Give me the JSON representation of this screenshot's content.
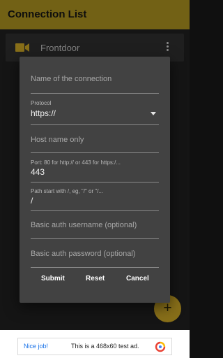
{
  "app": {
    "title": "Connection List"
  },
  "list": {
    "items": [
      {
        "label": "Frontdoor",
        "icon": "videocam-icon"
      }
    ]
  },
  "dialog": {
    "fields": {
      "name": {
        "placeholder": "Name of the connection",
        "value": ""
      },
      "protocol": {
        "label": "Protocol",
        "value": "https://"
      },
      "host": {
        "placeholder": "Host name only",
        "value": ""
      },
      "port": {
        "label": "Port: 80 for http:// or 443 for https:/...",
        "value": "443"
      },
      "path": {
        "label": "Path start with /, eg, \"/\" or \"/...",
        "value": "/"
      },
      "username": {
        "placeholder": "Basic auth username (optional)",
        "value": ""
      },
      "password": {
        "placeholder": "Basic auth password (optional)",
        "value": ""
      }
    },
    "buttons": {
      "submit": "Submit",
      "reset": "Reset",
      "cancel": "Cancel"
    }
  },
  "fab": {
    "label": "+"
  },
  "ad": {
    "badge": "Nice job!",
    "message": "This is a 468x60 test ad."
  },
  "colors": {
    "appbar": "#a8901f",
    "accent": "#c9a426",
    "dialog": "#424242",
    "camera_icon": "#c9a426"
  }
}
